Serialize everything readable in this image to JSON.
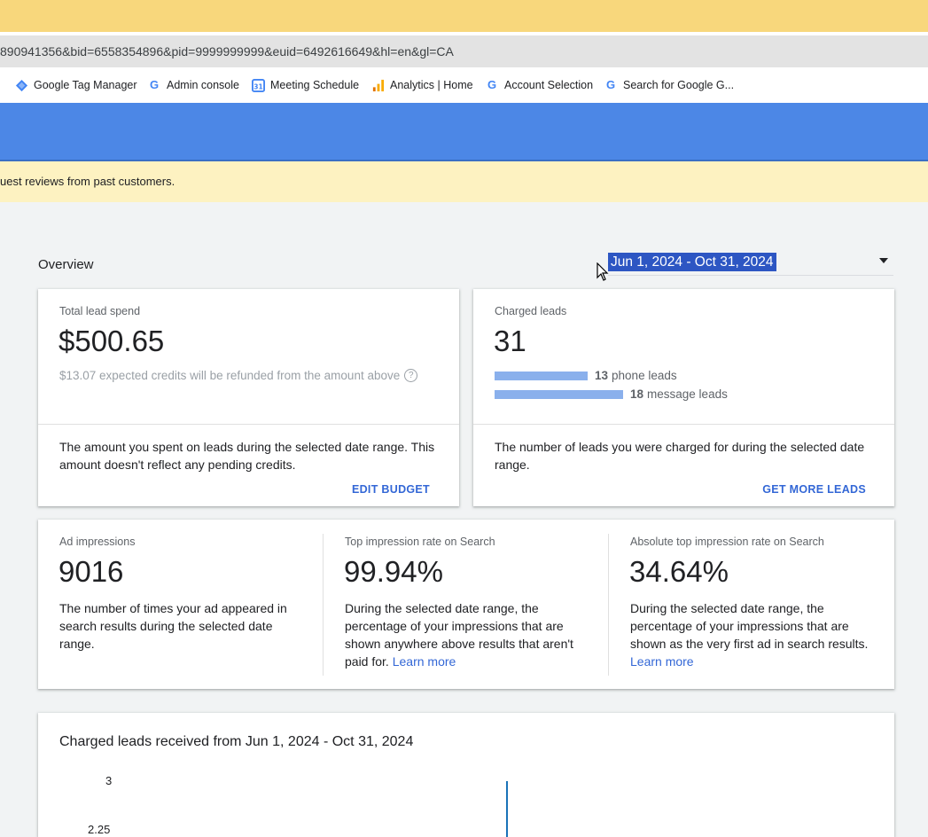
{
  "browser": {
    "url": "890941356&bid=6558354896&pid=9999999999&euid=6492616649&hl=en&gl=CA",
    "bookmarks": [
      {
        "label": "Google Tag Manager",
        "icon": "tag-manager-icon"
      },
      {
        "label": "Admin console",
        "icon": "google-g-icon"
      },
      {
        "label": "Meeting Schedule",
        "icon": "calendar-icon"
      },
      {
        "label": "Analytics | Home",
        "icon": "analytics-icon"
      },
      {
        "label": "Account Selection",
        "icon": "google-g-icon"
      },
      {
        "label": "Search for Google G...",
        "icon": "google-g-icon"
      }
    ]
  },
  "notice": {
    "text": "uest reviews from past customers."
  },
  "overview": {
    "title": "Overview",
    "date_range": "Jun 1, 2024 - Oct 31, 2024"
  },
  "spend_card": {
    "label": "Total lead spend",
    "value": "$500.65",
    "sub": "$13.07 expected credits will be refunded from the amount above",
    "help": "?",
    "description": "The amount you spent on leads during the selected date range. This amount doesn't reflect any pending credits.",
    "action": "EDIT BUDGET"
  },
  "leads_card": {
    "label": "Charged leads",
    "value": "31",
    "phone_count": "13",
    "phone_label": "phone leads",
    "message_count": "18",
    "message_label": "message leads",
    "phone_fraction": 0.42,
    "message_fraction": 0.58,
    "description": "The number of leads you were charged for during the selected date range.",
    "action": "GET MORE LEADS"
  },
  "metrics": [
    {
      "label": "Ad impressions",
      "value": "9016",
      "description": "The number of times your ad appeared in search results during the selected date range.",
      "link": ""
    },
    {
      "label": "Top impression rate on Search",
      "value": "99.94%",
      "description": "During the selected date range, the percentage of your impressions that are shown anywhere above results that aren't paid for.",
      "link": "Learn more"
    },
    {
      "label": "Absolute top impression rate on Search",
      "value": "34.64%",
      "description": "During the selected date range, the percentage of your impressions that are shown as the very first ad in search results.",
      "link": "Learn more"
    }
  ],
  "chart": {
    "title": "Charged leads received from Jun 1, 2024 - Oct 31, 2024",
    "y_ticks": [
      "3",
      "2.25"
    ]
  },
  "colors": {
    "accent_blue": "#4c87e6",
    "link": "#3367d6",
    "lead_bar": "#8ab0ec"
  }
}
